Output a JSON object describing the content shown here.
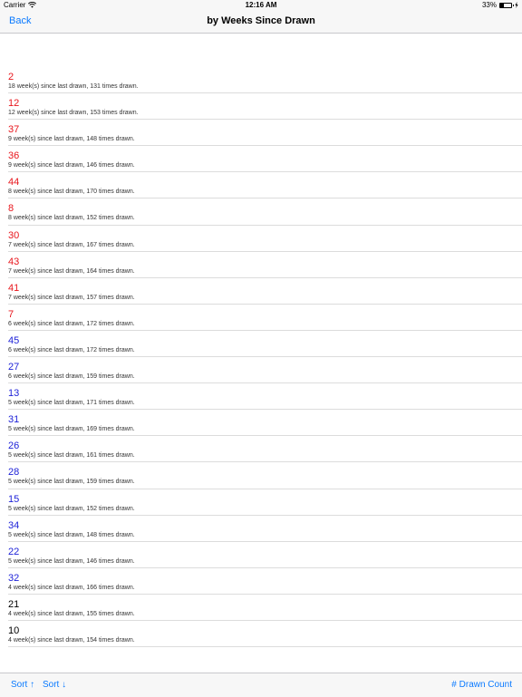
{
  "status_bar": {
    "carrier": "Carrier",
    "time": "12:16 AM",
    "battery": "33%",
    "battery_level": 0.33,
    "wifi_icon": "wifi-icon",
    "battery_icon": "battery-icon",
    "charging_icon": "charging-icon"
  },
  "nav": {
    "back_label": "Back",
    "title": "by Weeks Since Drawn"
  },
  "colors": {
    "red": "#e8161c",
    "blue": "#1f23d8",
    "black": "#000000",
    "accent": "#0a7aff"
  },
  "rows": [
    {
      "number": "2",
      "detail": "18 week(s) since last drawn, 131 times drawn.",
      "color": "#e8161c"
    },
    {
      "number": "12",
      "detail": "12 week(s) since last drawn, 153 times drawn.",
      "color": "#e8161c"
    },
    {
      "number": "37",
      "detail": "9 week(s) since last drawn, 148 times drawn.",
      "color": "#e8161c"
    },
    {
      "number": "36",
      "detail": "9 week(s) since last drawn, 146 times drawn.",
      "color": "#e8161c"
    },
    {
      "number": "44",
      "detail": "8 week(s) since last drawn, 170 times drawn.",
      "color": "#e8161c"
    },
    {
      "number": "8",
      "detail": "8 week(s) since last drawn, 152 times drawn.",
      "color": "#e8161c"
    },
    {
      "number": "30",
      "detail": "7 week(s) since last drawn, 167 times drawn.",
      "color": "#e8161c"
    },
    {
      "number": "43",
      "detail": "7 week(s) since last drawn, 164 times drawn.",
      "color": "#e8161c"
    },
    {
      "number": "41",
      "detail": "7 week(s) since last drawn, 157 times drawn.",
      "color": "#e8161c"
    },
    {
      "number": "7",
      "detail": "6 week(s) since last drawn, 172 times drawn.",
      "color": "#e8161c"
    },
    {
      "number": "45",
      "detail": "6 week(s) since last drawn, 172 times drawn.",
      "color": "#1f23d8"
    },
    {
      "number": "27",
      "detail": "6 week(s) since last drawn, 159 times drawn.",
      "color": "#1f23d8"
    },
    {
      "number": "13",
      "detail": "5 week(s) since last drawn, 171 times drawn.",
      "color": "#1f23d8"
    },
    {
      "number": "31",
      "detail": "5 week(s) since last drawn, 169 times drawn.",
      "color": "#1f23d8"
    },
    {
      "number": "26",
      "detail": "5 week(s) since last drawn, 161 times drawn.",
      "color": "#1f23d8"
    },
    {
      "number": "28",
      "detail": "5 week(s) since last drawn, 159 times drawn.",
      "color": "#1f23d8"
    },
    {
      "number": "15",
      "detail": "5 week(s) since last drawn, 152 times drawn.",
      "color": "#1f23d8"
    },
    {
      "number": "34",
      "detail": "5 week(s) since last drawn, 148 times drawn.",
      "color": "#1f23d8"
    },
    {
      "number": "22",
      "detail": "5 week(s) since last drawn, 146 times drawn.",
      "color": "#1f23d8"
    },
    {
      "number": "32",
      "detail": "4 week(s) since last drawn, 166 times drawn.",
      "color": "#1f23d8"
    },
    {
      "number": "21",
      "detail": "4 week(s) since last drawn, 155 times drawn.",
      "color": "#000000"
    },
    {
      "number": "10",
      "detail": "4 week(s) since last drawn, 154 times drawn.",
      "color": "#000000"
    }
  ],
  "toolbar": {
    "sort_up_label": "Sort ↑",
    "sort_down_label": "Sort ↓",
    "drawn_count_label": "# Drawn Count"
  }
}
